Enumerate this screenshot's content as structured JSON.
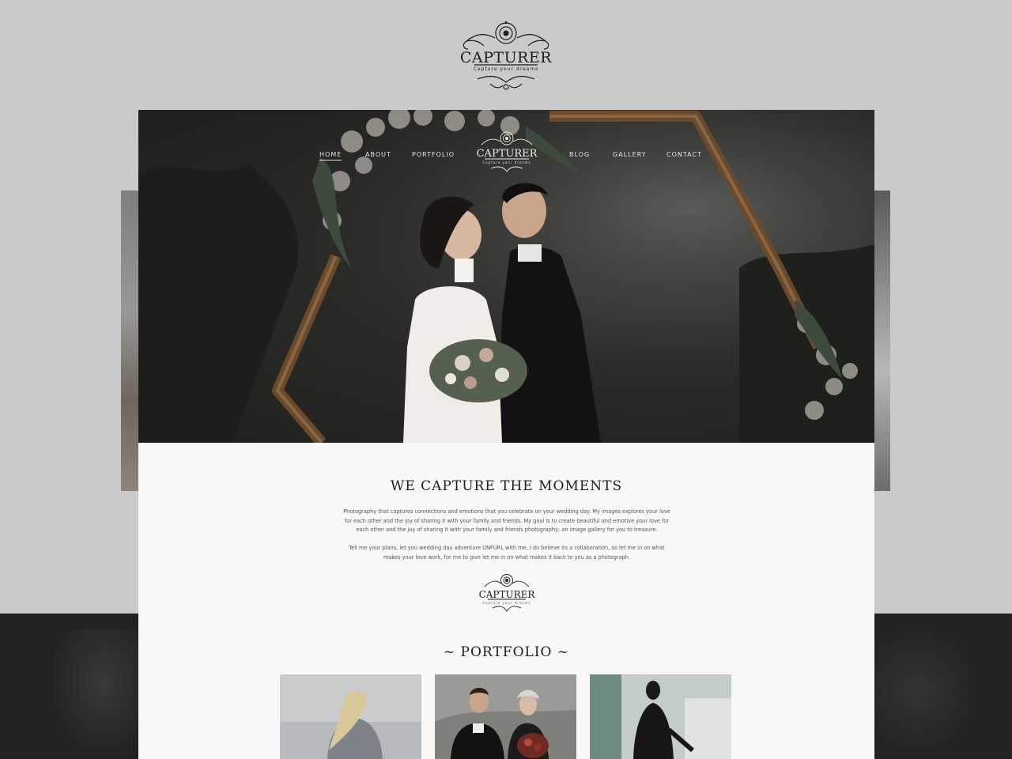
{
  "brand": {
    "name": "CAPTURER",
    "tagline": "Capture your dreams"
  },
  "nav": {
    "items": [
      "HOME",
      "ABOUT",
      "PORTFOLIO",
      "BLOG",
      "GALLERY",
      "CONTACT"
    ],
    "active": "HOME"
  },
  "about": {
    "title": "WE CAPTURE THE MOMENTS",
    "paragraph1": "Photography that captures connections and emotions that you celebrate on your wedding day. My images explores your love for each other and the joy of sharing it with your family and friends. My goal is to create beautiful and emotive your love for each other and the joy of sharing it with your family and friends photography; an image gallery for you to treasure.",
    "paragraph2": "Tell me your plans, let you wedding day adventure UNFURL with me. I do believe its a collaboration, so let me in on what makes your love work, for me to give let me in on what makes it back to you as a photograph."
  },
  "portfolio": {
    "title": "~ PORTFOLIO ~",
    "items": [
      {
        "name": "portfolio-photo-woman-windblown-hair"
      },
      {
        "name": "portfolio-photo-couple-tuxedo-bouquet"
      },
      {
        "name": "portfolio-photo-woman-black-outfit"
      }
    ]
  },
  "colors": {
    "page_background": "#cbcaca",
    "content_background": "#faf8f7",
    "dark_band": "#232222",
    "text_dark": "#1d1d1d",
    "nav_text": "#e9e6e2"
  }
}
